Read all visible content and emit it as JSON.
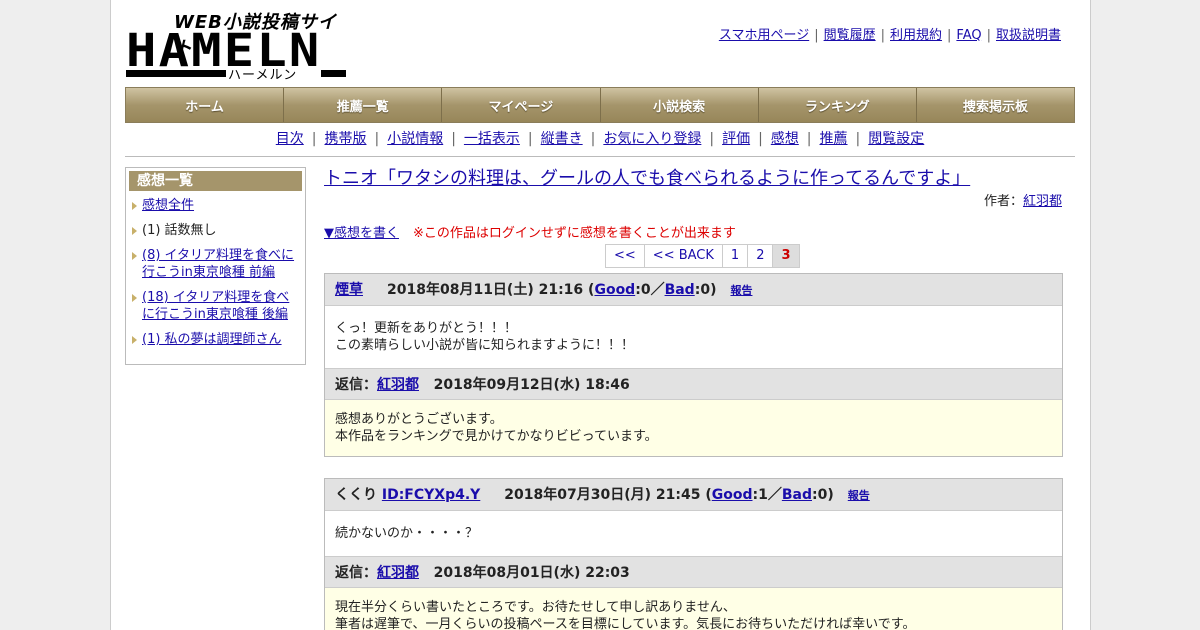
{
  "logo": {
    "tagline": "WEB小説投稿サイト",
    "word": "HAMELN",
    "kana": "ハーメルン"
  },
  "toplinks": [
    "スマホ用ページ",
    "閲覧履歴",
    "利用規約",
    "FAQ",
    "取扱説明書"
  ],
  "gnav": [
    "ホーム",
    "推薦一覧",
    "マイページ",
    "小説検索",
    "ランキング",
    "捜索掲示板"
  ],
  "subnav": [
    "目次",
    "携帯版",
    "小説情報",
    "一括表示",
    "縦書き",
    "お気に入り登録",
    "評価",
    "感想",
    "推薦",
    "閲覧設定"
  ],
  "sidebar": {
    "title": "感想一覧",
    "items": [
      {
        "label": "感想全件",
        "link": true
      },
      {
        "label": "(1) 話数無し",
        "link": false
      },
      {
        "label": "(8) イタリア料理を食べに行こうin東京喰種 前編",
        "link": true
      },
      {
        "label": "(18) イタリア料理を食べに行こうin東京喰種 後編",
        "link": true
      },
      {
        "label": "(1) 私の夢は調理師さん",
        "link": true
      }
    ]
  },
  "work": {
    "title": "トニオ「ワタシの料理は、グールの人でも食べられるように作ってるんですよ」",
    "author_label": "作者：",
    "author": "紅羽都"
  },
  "write_link": "▼感想を書く",
  "warning": "※この作品はログインせずに感想を書くことが出来ます",
  "pager": [
    {
      "label": "<<",
      "current": false
    },
    {
      "label": "<< BACK",
      "current": false
    },
    {
      "label": "1",
      "current": false
    },
    {
      "label": "2",
      "current": false
    },
    {
      "label": "3",
      "current": true
    }
  ],
  "posts": [
    {
      "name_prefix": "",
      "name": "煙草",
      "date": "2018年08月11日(土) 21:16",
      "good_label": "Good",
      "good": "0",
      "bad_label": "Bad",
      "bad": "0",
      "report": "報告",
      "body": [
        "くっ！更新をありがとう！！！",
        "この素晴らしい小説が皆に知られますように！！！"
      ],
      "reply_label": "返信：",
      "reply_author": "紅羽都",
      "reply_date": "2018年09月12日(水) 18:46",
      "reply_body": [
        "感想ありがとうございます。",
        "本作品をランキングで見かけてかなりビビっています。"
      ]
    },
    {
      "name_prefix": "くくり ",
      "name": "ID:FCYXp4.Y",
      "date": "2018年07月30日(月) 21:45",
      "good_label": "Good",
      "good": "1",
      "bad_label": "Bad",
      "bad": "0",
      "report": "報告",
      "body": [
        "続かないのか・・・・？"
      ],
      "reply_label": "返信：",
      "reply_author": "紅羽都",
      "reply_date": "2018年08月01日(水) 22:03",
      "reply_body": [
        "現在半分くらい書いたところです。お待たせして申し訳ありません、",
        "筆者は遅筆で、一月くらいの投稿ペースを目標にしています。気長にお待ちいただければ幸いです。"
      ]
    }
  ]
}
